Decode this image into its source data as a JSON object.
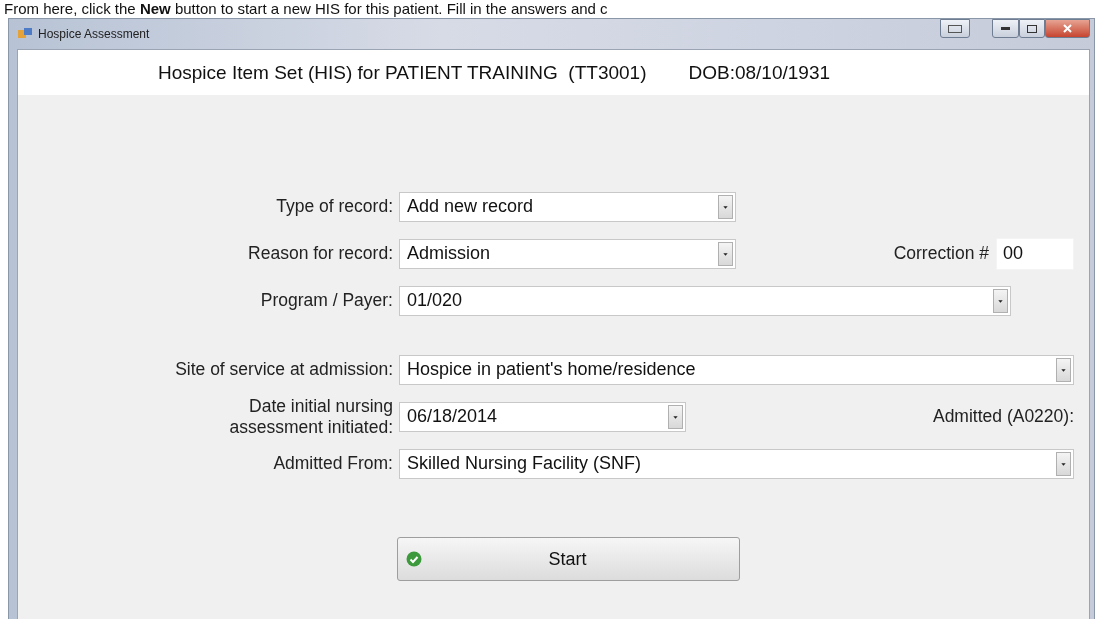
{
  "instruction": "From here, click the **New** button to start a new HIS for this patient. Fill in the answers and c",
  "window": {
    "title": "Hospice Assessment"
  },
  "header": {
    "title": "Hospice Item Set (HIS) for PATIENT TRAINING  (TT3001)",
    "dob": "DOB:08/10/1931"
  },
  "form": {
    "rows": [
      {
        "label": "Type of record:",
        "value": "Add new record"
      },
      {
        "label": "Reason for record:",
        "value": "Admission",
        "side": {
          "kind": "field",
          "label": "Correction #",
          "value": "00"
        }
      },
      {
        "label": "Program / Payer:",
        "value": "01/020"
      },
      {
        "label": "Site of service at admission:",
        "value": "Hospice in patient's home/residence"
      },
      {
        "label": "Date initial nursing\nassessment initiated:",
        "value": "06/18/2014",
        "side": {
          "kind": "label",
          "label": "Admitted (A0220):"
        }
      },
      {
        "label": "Admitted From:",
        "value": "Skilled Nursing Facility (SNF)"
      }
    ]
  },
  "start_button": {
    "label": "Start"
  }
}
